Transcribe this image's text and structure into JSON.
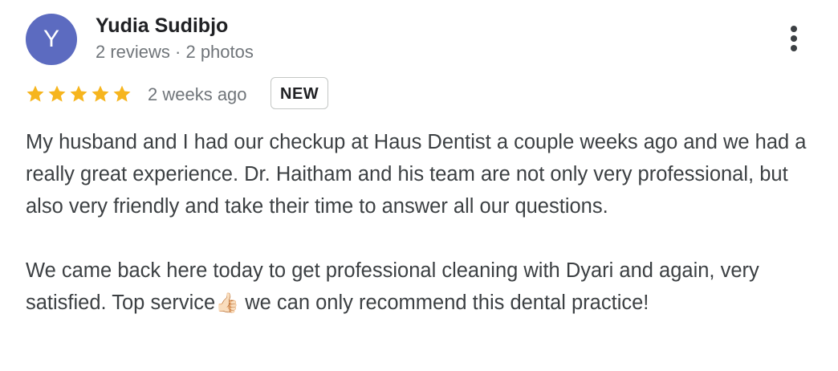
{
  "author": {
    "initial": "Y",
    "name": "Yudia Sudibjo",
    "meta": "2 reviews · 2 photos",
    "avatar_color": "#5c6bc0"
  },
  "rating": {
    "stars": 5,
    "max_stars": 5,
    "star_color": "#f6b51e",
    "date": "2 weeks ago",
    "badge": "NEW"
  },
  "menu": {
    "icon": "more-vert-icon"
  },
  "review": {
    "paragraph_1": "My husband and I had our checkup at Haus Dentist a couple weeks ago and we had a really great experience. Dr. Haitham and his team are not only very professional, but also very friendly and take their time to answer all our questions.",
    "paragraph_2_before_emoji": "We came back here today to get professional cleaning with Dyari and again, very satisfied. Top service",
    "emoji": "👍🏻",
    "emoji_name": "thumbs-up-icon",
    "paragraph_2_after_emoji": " we can only recommend this dental practice!"
  }
}
